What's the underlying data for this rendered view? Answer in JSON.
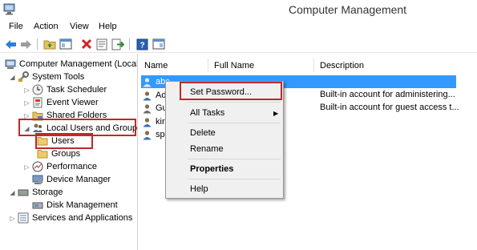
{
  "window": {
    "title": "Computer Management",
    "accent": "#3399ff",
    "highlight": "#c0282d"
  },
  "menu": [
    "File",
    "Action",
    "View",
    "Help"
  ],
  "toolbar": [
    "back-arrow-icon",
    "forward-arrow-icon",
    "up-folder-icon",
    "show-hide-tree-icon",
    "delete-icon",
    "properties-icon",
    "export-icon",
    "help-icon",
    "show-action-pane-icon"
  ],
  "tree": {
    "root": "Computer Management (Local",
    "system_tools": "System Tools",
    "task_scheduler": "Task Scheduler",
    "event_viewer": "Event Viewer",
    "shared_folders": "Shared Folders",
    "local_users_groups": "Local Users and Groups",
    "users": "Users",
    "groups": "Groups",
    "performance": "Performance",
    "device_manager": "Device Manager",
    "storage": "Storage",
    "disk_management": "Disk Management",
    "services_apps": "Services and Applications"
  },
  "list": {
    "columns": [
      "Name",
      "Full Name",
      "Description"
    ],
    "rows": [
      {
        "name": "abc",
        "description": ""
      },
      {
        "name": "Ad",
        "description": "Built-in account for administering..."
      },
      {
        "name": "Gu",
        "description": "Built-in account for guest access t..."
      },
      {
        "name": "kir",
        "description": ""
      },
      {
        "name": "spe",
        "description": ""
      }
    ]
  },
  "context_menu": {
    "set_password": "Set Password...",
    "all_tasks": "All Tasks",
    "delete": "Delete",
    "rename": "Rename",
    "properties": "Properties",
    "help": "Help"
  }
}
